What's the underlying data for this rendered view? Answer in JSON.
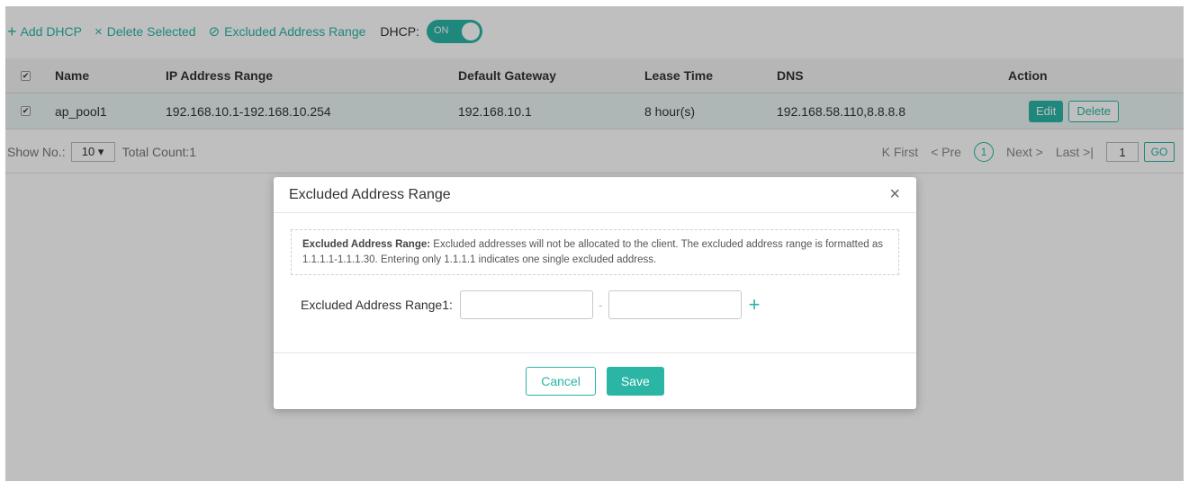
{
  "toolbar": {
    "add_label": "Add DHCP",
    "delete_label": "Delete Selected",
    "excluded_label": "Excluded Address Range",
    "dhcp_label": "DHCP:",
    "dhcp_toggle": "ON"
  },
  "table": {
    "headers": {
      "name": "Name",
      "ip_range": "IP Address Range",
      "gateway": "Default Gateway",
      "lease": "Lease Time",
      "dns": "DNS",
      "action": "Action"
    },
    "rows": [
      {
        "name": "ap_pool1",
        "ip_range": "192.168.10.1-192.168.10.254",
        "gateway": "192.168.10.1",
        "lease": "8 hour(s)",
        "dns": "192.168.58.110,8.8.8.8",
        "edit": "Edit",
        "delete": "Delete"
      }
    ]
  },
  "pager": {
    "show_label": "Show No.:",
    "page_size": "10 ▾",
    "total": "Total Count:1",
    "first": "K First",
    "prev": "< Pre",
    "current": "1",
    "next": "Next >",
    "last": "Last >|",
    "goto_value": "1",
    "go": "GO"
  },
  "modal": {
    "title": "Excluded Address Range",
    "close": "×",
    "tip_title": "Excluded Address Range:",
    "tip_text": "Excluded addresses will not be allocated to the client. The excluded address range is formatted as 1.1.1.1-1.1.1.30. Entering only 1.1.1.1 indicates one single excluded address.",
    "range_label": "Excluded Address Range1:",
    "dash": "-",
    "cancel": "Cancel",
    "save": "Save"
  },
  "colors": {
    "accent": "#2ab5a5"
  }
}
